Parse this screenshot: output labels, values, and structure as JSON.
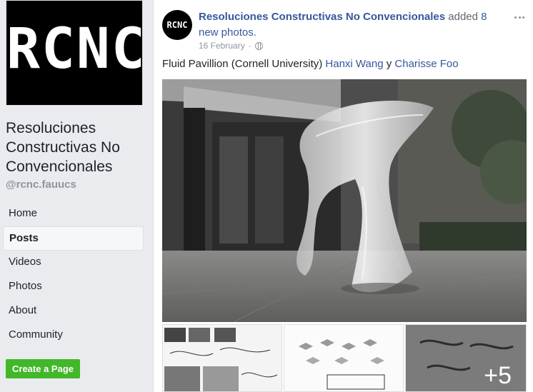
{
  "page": {
    "logo_text": "RCNC",
    "name": "Resoluciones Constructivas No Convencionales",
    "handle": "@rcnc.fauucs"
  },
  "nav": {
    "items": [
      "Home",
      "Posts",
      "Videos",
      "Photos",
      "About",
      "Community"
    ],
    "active": "Posts",
    "create_button": "Create a Page"
  },
  "post": {
    "avatar_text": "RCNC",
    "author": "Resoluciones Constructivas No Convencionales",
    "action_prefix": "added",
    "action_count": "8",
    "action_suffix": "new photos.",
    "date": "16 February",
    "privacy_icon": "globe-icon",
    "text_prefix": "Fluid Pavillion (Cornell University)",
    "tag1": "Hanxi Wang",
    "conjunction": "y",
    "tag2": "Charisse Foo",
    "more_photos": "+5"
  },
  "colors": {
    "link": "#365899",
    "button": "#42b72a",
    "sidebar_bg": "#e9ebee"
  }
}
